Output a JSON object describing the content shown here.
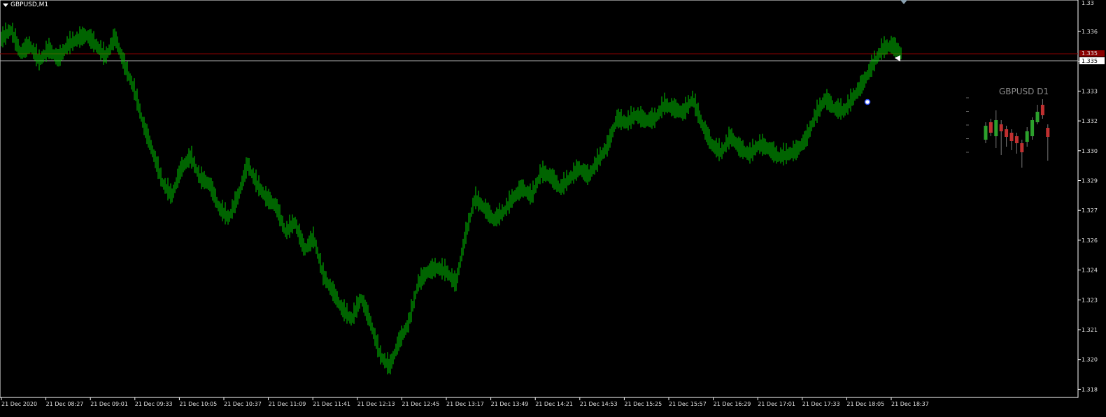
{
  "window": {
    "symbol_title": "GBPUSD,M1"
  },
  "colors": {
    "background": "#000000",
    "bar": "#00c800",
    "bid_line": "#b0b0b0",
    "ask_line": "#8b0000",
    "axis": "#ffffff",
    "mini_up": "#2ca02c",
    "mini_down": "#c03030"
  },
  "price_axis": {
    "labels": [
      "1.336",
      "1.335",
      "1.333",
      "1.332",
      "1.330",
      "1.329",
      "1.327",
      "1.326",
      "1.324",
      "1.323",
      "1.321",
      "1.320",
      "1.318"
    ],
    "top_label": "1.33",
    "bid_label": "1.335",
    "ask_label": "1.335"
  },
  "time_axis": {
    "labels": [
      "21 Dec 2020",
      "21 Dec 08:27",
      "21 Dec 09:01",
      "21 Dec 09:33",
      "21 Dec 10:05",
      "21 Dec 10:37",
      "21 Dec 11:09",
      "21 Dec 11:41",
      "21 Dec 12:13",
      "21 Dec 12:45",
      "21 Dec 13:17",
      "21 Dec 13:49",
      "21 Dec 14:21",
      "21 Dec 14:53",
      "21 Dec 15:25",
      "21 Dec 15:57",
      "21 Dec 16:29",
      "21 Dec 17:01",
      "21 Dec 17:33",
      "21 Dec 18:05",
      "21 Dec 18:37"
    ]
  },
  "mini_chart": {
    "title": "GBPUSD D1"
  },
  "chart_data": {
    "type": "line",
    "title": "GBPUSD,M1",
    "ylim": [
      1.3175,
      1.3375
    ],
    "series": [
      {
        "values": [
          1.3355,
          1.336,
          1.3348,
          1.3352,
          1.3344,
          1.335,
          1.3345,
          1.3352,
          1.3355,
          1.3357,
          1.3352,
          1.3346,
          1.3356,
          1.3342,
          1.333,
          1.3312,
          1.3298,
          1.3283,
          1.3276,
          1.329,
          1.3296,
          1.3285,
          1.3282,
          1.327,
          1.3265,
          1.3276,
          1.3292,
          1.3282,
          1.3275,
          1.3271,
          1.3258,
          1.3263,
          1.3249,
          1.3255,
          1.3236,
          1.3228,
          1.3219,
          1.3214,
          1.3225,
          1.3212,
          1.3196,
          1.319,
          1.3203,
          1.3212,
          1.3232,
          1.3238,
          1.324,
          1.3238,
          1.3232,
          1.3256,
          1.3275,
          1.327,
          1.3264,
          1.3268,
          1.3275,
          1.328,
          1.3276,
          1.3288,
          1.3286,
          1.328,
          1.3285,
          1.329,
          1.3286,
          1.3294,
          1.3301,
          1.3315,
          1.3313,
          1.3317,
          1.3314,
          1.3315,
          1.3322,
          1.332,
          1.3318,
          1.3325,
          1.3312,
          1.3302,
          1.3298,
          1.3306,
          1.33,
          1.3297,
          1.3302,
          1.33,
          1.3296,
          1.3297,
          1.3299,
          1.3305,
          1.3317,
          1.3325,
          1.332,
          1.3319,
          1.3326,
          1.3333,
          1.3342,
          1.335,
          1.3352,
          1.3348
        ]
      }
    ]
  }
}
